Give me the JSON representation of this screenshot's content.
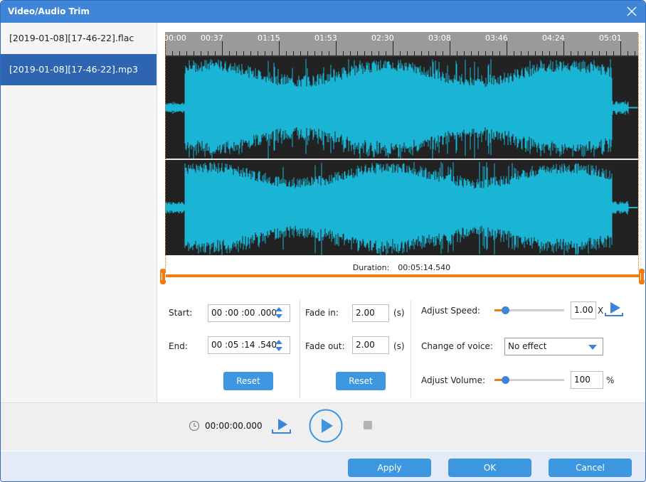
{
  "window": {
    "title": "Video/Audio Trim",
    "close_icon": "close-icon"
  },
  "sidebar": {
    "files": [
      {
        "name": "[2019-01-08][17-46-22].flac",
        "selected": false
      },
      {
        "name": "[2019-01-08][17-46-22].mp3",
        "selected": true
      }
    ]
  },
  "timeline": {
    "ruler_labels": [
      "00:00",
      "00:37",
      "01:15",
      "01:53",
      "02:30",
      "03:08",
      "03:46",
      "04:24",
      "05:01"
    ],
    "duration_label": "Duration:",
    "duration_value": "00:05:14.540",
    "trim_start_fraction": 0.0,
    "trim_end_fraction": 1.0,
    "waveform_color": "#1ab4d4",
    "trim_color": "#f07d0e"
  },
  "trim": {
    "start_label": "Start:",
    "start_value": "00 :00 :00 .000",
    "end_label": "End:",
    "end_value": "00 :05 :14 .540",
    "reset_label": "Reset"
  },
  "fade": {
    "fade_in_label": "Fade in:",
    "fade_in_value": "2.00",
    "fade_out_label": "Fade out:",
    "fade_out_value": "2.00",
    "unit": "(s)",
    "reset_label": "Reset"
  },
  "audio": {
    "speed_label": "Adjust Speed:",
    "speed_value": "1.00",
    "speed_unit": "X",
    "speed_slider_fraction": 0.15,
    "voice_label": "Change of voice:",
    "voice_selected": "No effect",
    "volume_label": "Adjust Volume:",
    "volume_value": "100",
    "volume_unit": "%",
    "volume_slider_fraction": 0.15
  },
  "player": {
    "current_time": "00:00:00.000"
  },
  "footer": {
    "apply_label": "Apply",
    "ok_label": "OK",
    "cancel_label": "Cancel"
  }
}
